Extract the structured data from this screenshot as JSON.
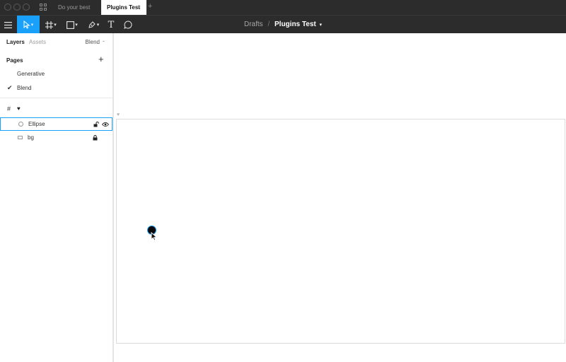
{
  "titlebar": {
    "tabs": [
      {
        "label": "Do your best",
        "active": false
      },
      {
        "label": "Plugins Test",
        "active": true
      }
    ],
    "close_glyph": "×",
    "add_glyph": "+"
  },
  "toolbar": {
    "tools": [
      "menu-icon",
      "move-icon",
      "frame-icon",
      "rectangle-icon",
      "pen-icon",
      "text-icon",
      "comment-icon"
    ],
    "text_tool_glyph": "T",
    "breadcrumb": {
      "parent": "Drafts",
      "separator": "/",
      "file": "Plugins Test"
    }
  },
  "left_panel": {
    "tabs": [
      "Layers",
      "Assets"
    ],
    "current_page": "Blend",
    "pages_header": "Pages",
    "add_glyph": "+",
    "pages": [
      {
        "label": "Generative",
        "selected": false
      },
      {
        "label": "Blend",
        "selected": true
      }
    ],
    "layers": [
      {
        "label": "",
        "icon": "frame-icon",
        "badge": "heart-icon"
      },
      {
        "label": "Ellipse",
        "icon": "ellipse-icon",
        "unlocked": true,
        "visible": true,
        "selected": true
      },
      {
        "label": "bg",
        "icon": "rectangle-icon",
        "locked": true
      }
    ]
  },
  "colors": {
    "accent": "#18a0fb",
    "chrome": "#2c2c2c",
    "canvas": "#ffffff"
  }
}
